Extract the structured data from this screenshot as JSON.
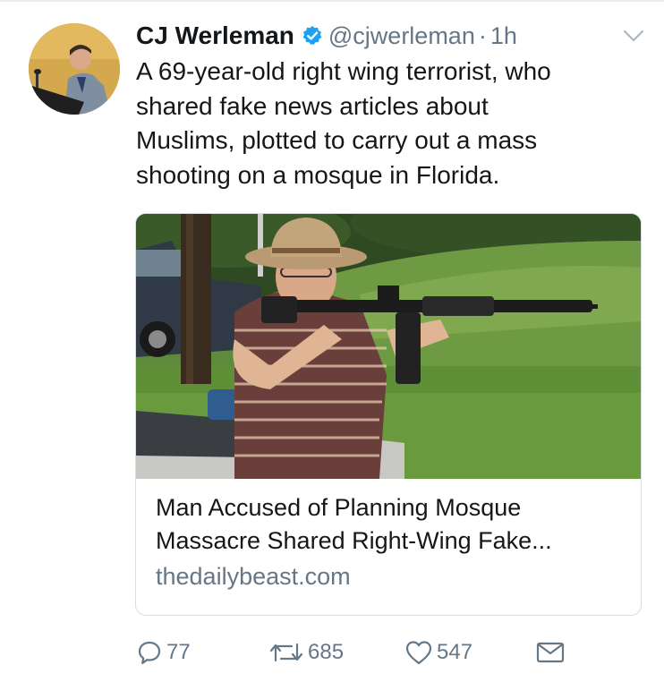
{
  "tweet": {
    "author_name": "CJ Werleman",
    "handle": "@cjwerleman",
    "separator": "·",
    "time": "1h",
    "verified": true,
    "text": "A 69-year-old right wing terrorist, who\nshared fake news articles about\nMuslims, plotted to carry out a mass\nshooting on a mosque in Florida."
  },
  "card": {
    "title": "Man Accused of Planning Mosque\nMassacre Shared Right-Wing Fake...",
    "domain": "thedailybeast.com"
  },
  "actions": {
    "reply_count": "77",
    "retweet_count": "685",
    "like_count": "547"
  },
  "icons": {
    "verified": "verified-badge-icon",
    "caret": "chevron-down-icon",
    "reply": "reply-icon",
    "retweet": "retweet-icon",
    "like": "heart-icon",
    "dm": "envelope-icon"
  },
  "colors": {
    "verified": "#1da1f2",
    "secondary_text": "#657786",
    "primary_text": "#14171a",
    "border": "#d8dee3"
  }
}
